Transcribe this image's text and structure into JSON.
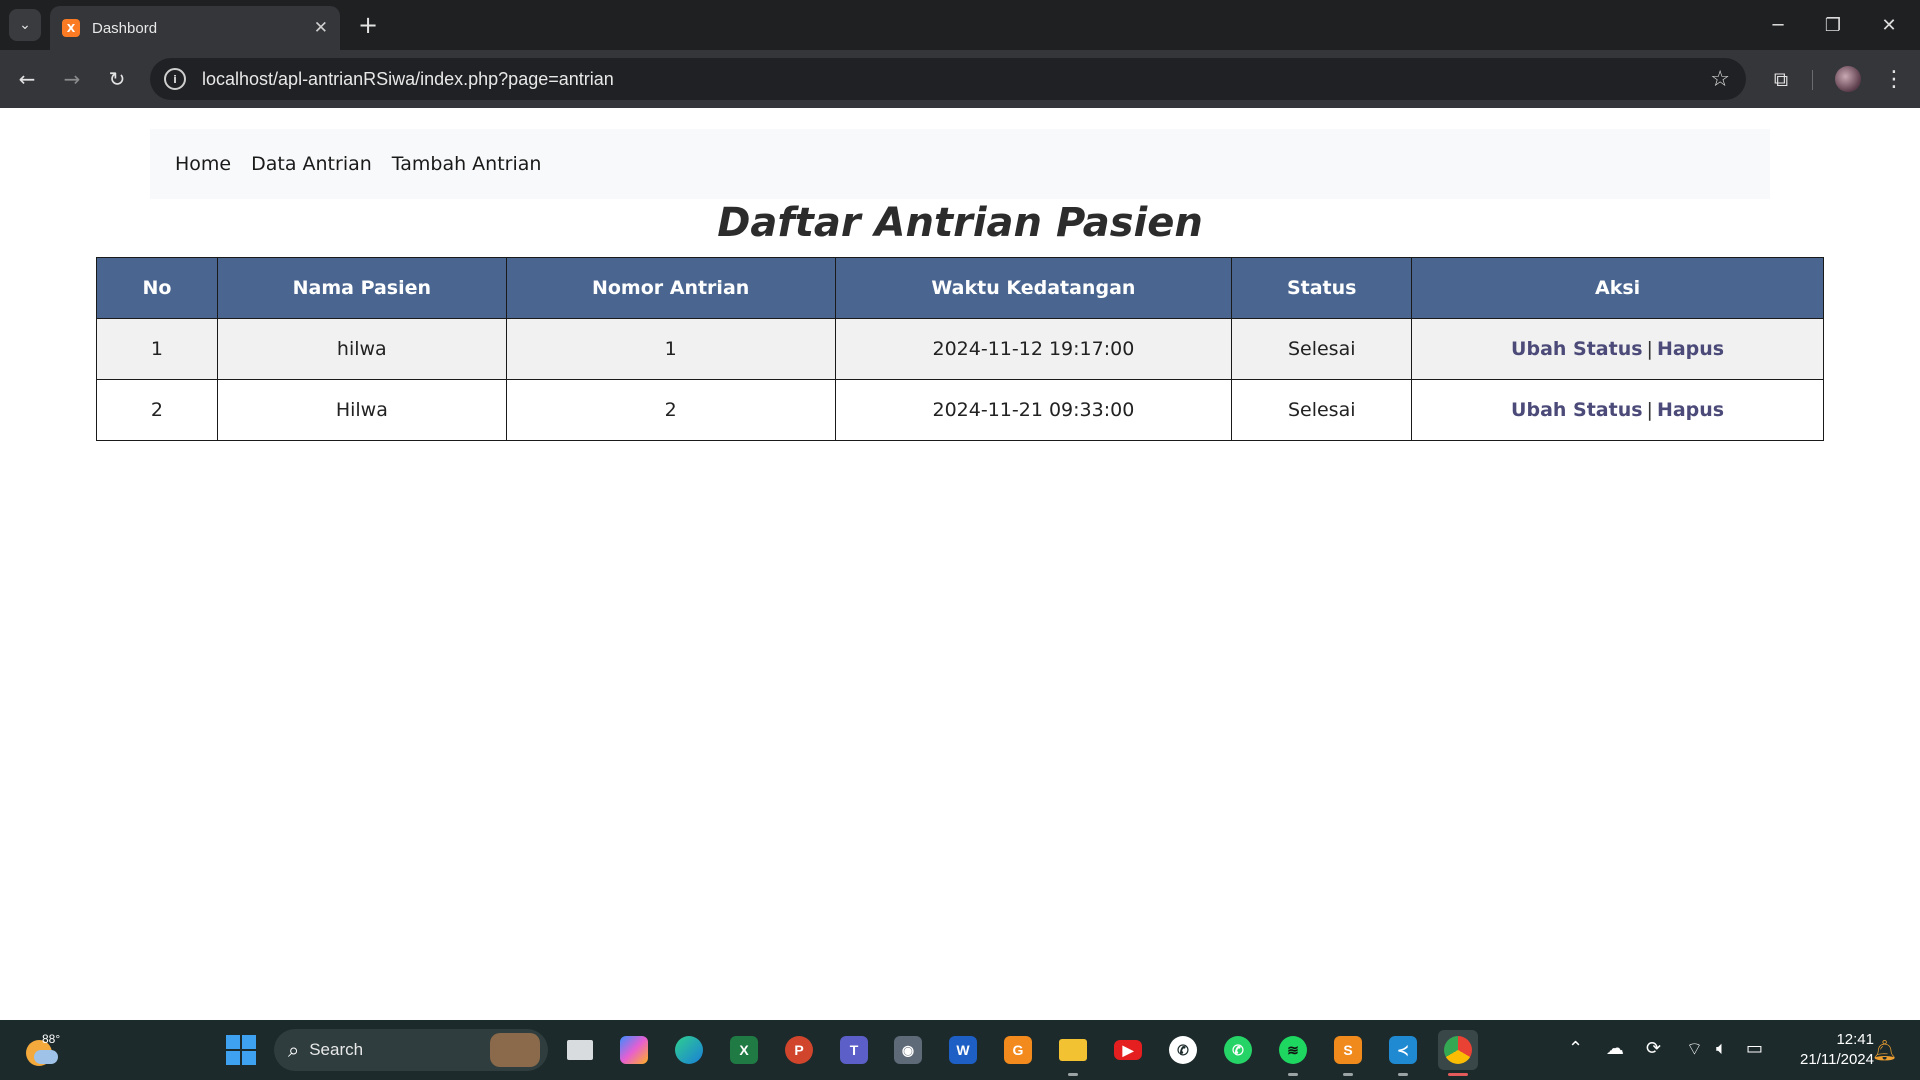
{
  "browser": {
    "tab_title": "Dashbord",
    "tab_favicon_text": "X",
    "url": "localhost/apl-antrianRSiwa/index.php?page=antrian"
  },
  "navbar": {
    "items": [
      {
        "label": "Home"
      },
      {
        "label": "Data Antrian"
      },
      {
        "label": "Tambah Antrian"
      }
    ]
  },
  "page": {
    "title": "Daftar Antrian Pasien"
  },
  "table": {
    "headers": [
      "No",
      "Nama Pasien",
      "Nomor Antrian",
      "Waktu Kedatangan",
      "Status",
      "Aksi"
    ],
    "rows": [
      {
        "no": "1",
        "nama": "hilwa",
        "nomor": "1",
        "waktu": "2024-11-12 19:17:00",
        "status": "Selesai",
        "edit": "Ubah Status",
        "sep": "|",
        "delete": "Hapus"
      },
      {
        "no": "2",
        "nama": "Hilwa",
        "nomor": "2",
        "waktu": "2024-11-21 09:33:00",
        "status": "Selesai",
        "edit": "Ubah Status",
        "sep": "|",
        "delete": "Hapus"
      }
    ],
    "colors": {
      "header_bg": "#4a6690",
      "link": "#4b4a78"
    }
  },
  "taskbar": {
    "weather_temp": "88°",
    "search_label": "Search",
    "clock_time": "12:41",
    "clock_date": "21/11/2024",
    "apps": [
      "task-view",
      "copilot",
      "edge",
      "excel",
      "powerpoint",
      "teams",
      "camera",
      "word",
      "pdf",
      "file-explorer",
      "youtube",
      "whatsapp",
      "whatsapp-business",
      "spotify",
      "sublime-text",
      "vscode",
      "chrome"
    ]
  }
}
